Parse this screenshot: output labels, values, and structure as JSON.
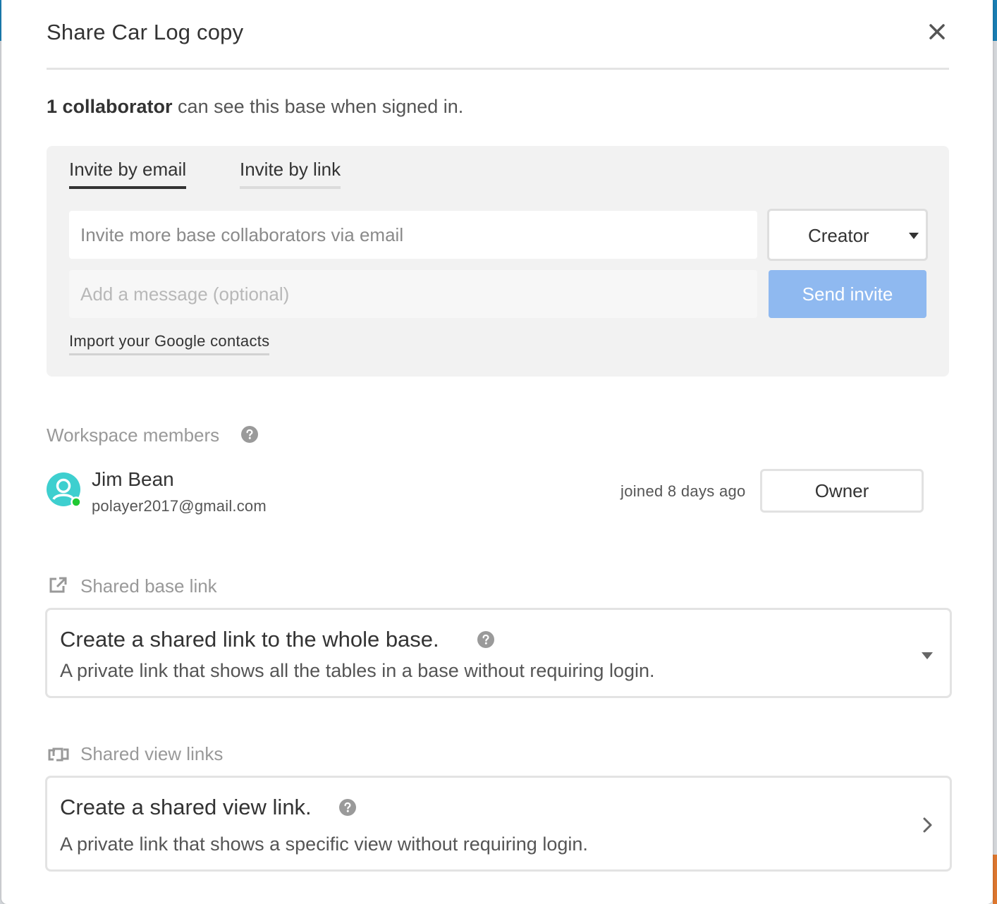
{
  "dialog": {
    "title": "Share Car Log copy"
  },
  "collaborators": {
    "count_label": "1 collaborator",
    "suffix": " can see this base when signed in."
  },
  "invite": {
    "tabs": [
      {
        "label": "Invite by email",
        "active": true
      },
      {
        "label": "Invite by link",
        "active": false
      }
    ],
    "email_placeholder": "Invite more base collaborators via email",
    "email_value": "",
    "message_placeholder": "Add a message (optional)",
    "message_value": "",
    "role_selected": "Creator",
    "send_label": "Send invite",
    "import_label": "Import your Google contacts"
  },
  "workspace": {
    "heading": "Workspace members",
    "members": [
      {
        "name": "Jim Bean",
        "email": "polayer2017@gmail.com",
        "joined": "joined 8 days ago",
        "role": "Owner",
        "online": true
      }
    ]
  },
  "shared_base": {
    "heading": "Shared base link",
    "card_title": "Create a shared link to the whole base.",
    "card_desc": "A private link that shows all the tables in a base without requiring login."
  },
  "shared_view": {
    "heading": "Shared view links",
    "card_title": "Create a shared view link.",
    "card_desc": "A private link that shows a specific view without requiring login."
  },
  "colors": {
    "send_button": "#8fb9f0",
    "avatar": "#3ecfcf",
    "online_dot": "#20c933",
    "muted_heading": "#999999"
  },
  "icons": {
    "close": "close-icon",
    "help": "question-circle-icon",
    "dropdown": "caret-down-icon",
    "external_link": "external-link-icon",
    "shared_views": "shared-views-icon",
    "chevron": "chevron-right-icon"
  }
}
